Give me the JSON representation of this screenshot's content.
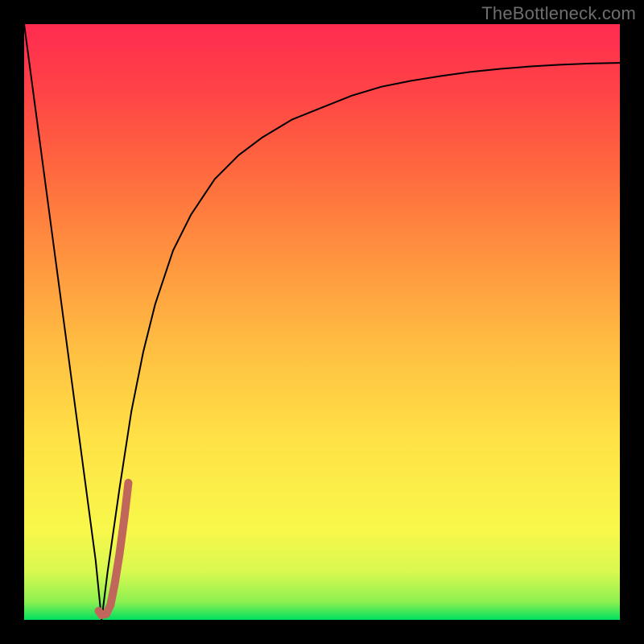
{
  "watermark": "TheBottleneck.com",
  "chart_data": {
    "type": "line",
    "title": "",
    "xlabel": "",
    "ylabel": "",
    "xlim": [
      0,
      100
    ],
    "ylim": [
      0,
      100
    ],
    "grid": false,
    "legend": false,
    "series": [
      {
        "name": "bottleneck-curve",
        "x": [
          0,
          2,
          4,
          6,
          8,
          10,
          12,
          13,
          14,
          16,
          18,
          20,
          22,
          25,
          28,
          32,
          36,
          40,
          45,
          50,
          55,
          60,
          65,
          70,
          75,
          80,
          85,
          90,
          95,
          100
        ],
        "y": [
          100,
          85,
          70,
          55,
          40,
          25,
          10,
          0,
          8,
          22,
          35,
          45,
          53,
          62,
          68,
          74,
          78,
          81,
          84,
          86,
          88,
          89.5,
          90.5,
          91.3,
          92,
          92.5,
          92.9,
          93.2,
          93.4,
          93.5
        ],
        "color": "#000000",
        "stroke_width": 2
      },
      {
        "name": "optimal-marker",
        "x": [
          12.5,
          13,
          13.8,
          14.5,
          15.2,
          16,
          16.8,
          17.5
        ],
        "y": [
          1.5,
          0.8,
          1.0,
          2.5,
          6,
          11,
          17,
          23
        ],
        "color": "#c1665b",
        "stroke_width": 10
      }
    ],
    "background_gradient": {
      "stops": [
        {
          "pos": 0.0,
          "color": "#00e060"
        },
        {
          "pos": 0.03,
          "color": "#8cf050"
        },
        {
          "pos": 0.08,
          "color": "#d8f850"
        },
        {
          "pos": 0.15,
          "color": "#f8f84a"
        },
        {
          "pos": 0.3,
          "color": "#ffe246"
        },
        {
          "pos": 0.45,
          "color": "#ffc042"
        },
        {
          "pos": 0.6,
          "color": "#ff963f"
        },
        {
          "pos": 0.75,
          "color": "#ff6a3e"
        },
        {
          "pos": 0.88,
          "color": "#ff4546"
        },
        {
          "pos": 1.0,
          "color": "#ff2b50"
        }
      ]
    }
  }
}
